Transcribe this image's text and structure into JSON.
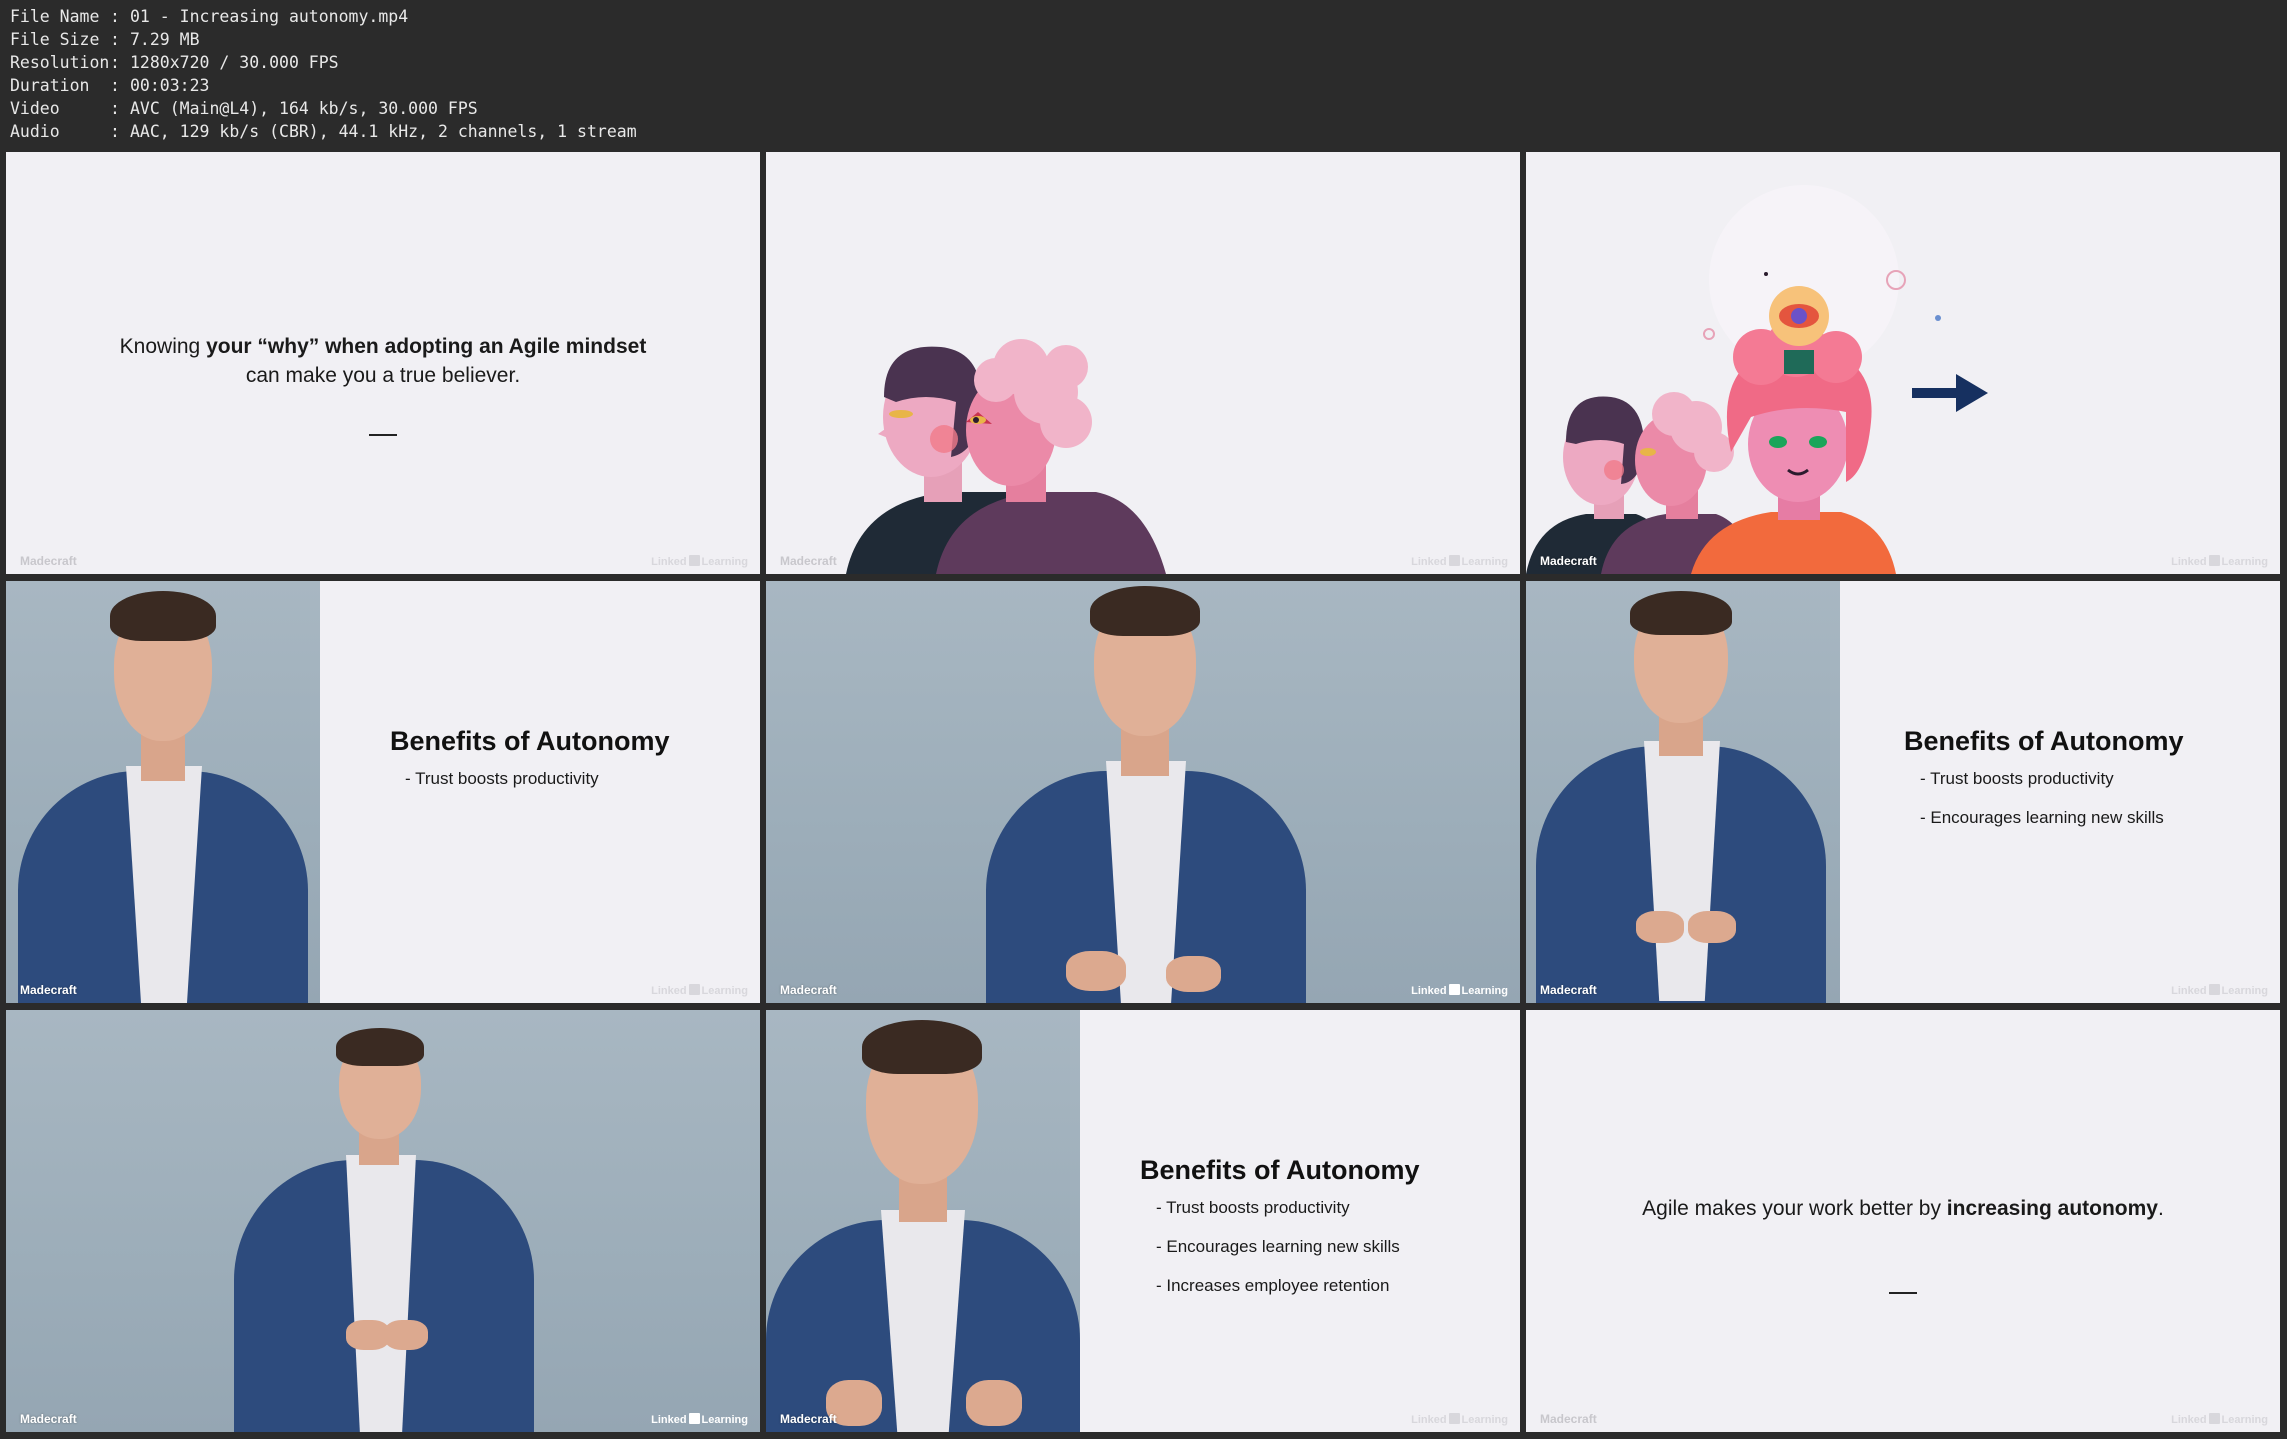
{
  "meta": {
    "rows": [
      {
        "key": "File Name",
        "sep": ":",
        "value": "01 - Increasing autonomy.mp4"
      },
      {
        "key": "File Size",
        "sep": ":",
        "value": "7.29 MB"
      },
      {
        "key": "Resolution",
        "sep": ":",
        "value": "1280x720 / 30.000 FPS"
      },
      {
        "key": "Duration",
        "sep": ":",
        "value": "00:03:23"
      },
      {
        "key": "Video",
        "sep": ":",
        "value": "AVC (Main@L4), 164 kb/s, 30.000 FPS"
      },
      {
        "key": "Audio",
        "sep": ":",
        "value": "AAC, 129 kb/s (CBR), 44.1 kHz, 2 channels, 1 stream"
      }
    ]
  },
  "watermark": {
    "brand": "Madecraft",
    "linked": "Linked",
    "learning": "Learning"
  },
  "frames": {
    "f1": {
      "line1_plain": "Knowing ",
      "line1_bold": "your “why” when adopting an Agile mindset",
      "line2": "can make you a true believer."
    },
    "benefits_title": "Benefits of Autonomy",
    "bullets": [
      "- Trust boosts productivity",
      "- Encourages learning new skills",
      "- Increases employee retention"
    ],
    "f9": {
      "plain": "Agile makes your work better by ",
      "bold": "increasing autonomy",
      "end": "."
    }
  },
  "colors": {
    "slide_bg": "#f1f0f4",
    "studio_bg": "#a3b3bf",
    "suit": "#2d4b7d",
    "arrow": "#163060",
    "orange": "#f26a3d",
    "pink": "#ec8fb0"
  }
}
